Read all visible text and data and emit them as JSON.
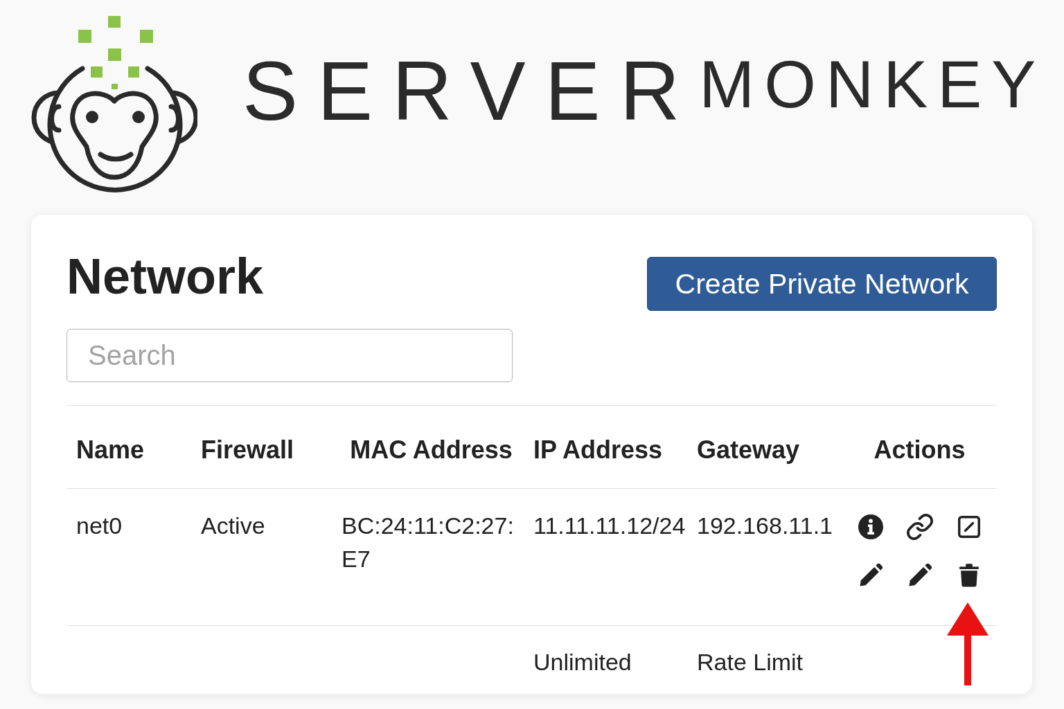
{
  "logo": {
    "primary": "SERVER",
    "secondary": "MONKEY"
  },
  "panel": {
    "title": "Network",
    "create_button": "Create Private Network",
    "search": {
      "placeholder": "Search"
    },
    "table": {
      "columns": [
        "Name",
        "Firewall",
        "MAC Address",
        "IP Address",
        "Gateway",
        "Actions"
      ],
      "rows": [
        {
          "name": "net0",
          "firewall": "Active",
          "mac_address": "BC:24:11:C2:27:E7",
          "ip_address": "11.11.11.12/24",
          "gateway": "192.168.11.1",
          "actions": [
            {
              "kind": "info"
            },
            {
              "kind": "link"
            },
            {
              "kind": "square"
            },
            {
              "kind": "pencil"
            },
            {
              "kind": "pencil"
            },
            {
              "kind": "trash"
            }
          ]
        },
        {
          "ip_address": "Unlimited",
          "gateway": "Rate Limit"
        }
      ]
    }
  }
}
